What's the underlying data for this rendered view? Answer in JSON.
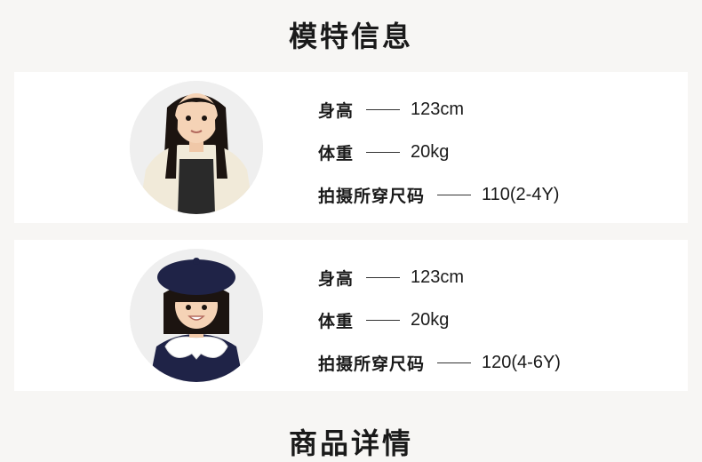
{
  "sections": {
    "model_info_title": "模特信息",
    "product_details_title": "商品详情"
  },
  "models": [
    {
      "rows": [
        {
          "label": "身高",
          "value": "123cm"
        },
        {
          "label": "体重",
          "value": "20kg"
        },
        {
          "label": "拍摄所穿尺码",
          "value": "110(2-4Y)"
        }
      ]
    },
    {
      "rows": [
        {
          "label": "身高",
          "value": "123cm"
        },
        {
          "label": "体重",
          "value": "20kg"
        },
        {
          "label": "拍摄所穿尺码",
          "value": "120(4-6Y)"
        }
      ]
    }
  ]
}
